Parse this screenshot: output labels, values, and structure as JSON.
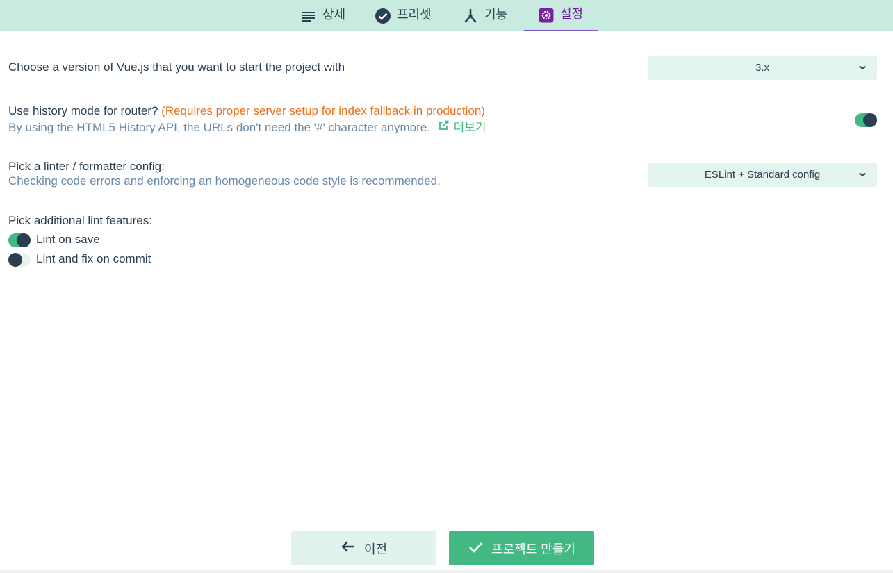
{
  "tabs": [
    {
      "label": "상세",
      "icon": "list-icon",
      "active": false
    },
    {
      "label": "프리셋",
      "icon": "check-circle-icon",
      "active": false
    },
    {
      "label": "기능",
      "icon": "fork-icon",
      "active": false
    },
    {
      "label": "설정",
      "icon": "gear-icon",
      "active": true
    }
  ],
  "vue_version": {
    "title": "Choose a version of Vue.js that you want to start the project with",
    "selected": "3.x"
  },
  "history_mode": {
    "title": "Use history mode for router?",
    "warning": "(Requires proper server setup for index fallback in production)",
    "description": "By using the HTML5 History API, the URLs don't need the '#' character anymore.",
    "more_link": "더보기",
    "enabled": true
  },
  "linter": {
    "title": "Pick a linter / formatter config:",
    "description": "Checking code errors and enforcing an homogeneous code style is recommended.",
    "selected": "ESLint + Standard config"
  },
  "lint_features": {
    "title": "Pick additional lint features:",
    "items": [
      {
        "label": "Lint on save",
        "enabled": true
      },
      {
        "label": "Lint and fix on commit",
        "enabled": false
      }
    ]
  },
  "buttons": {
    "prev_label": "이전",
    "create_label": "프로젝트 만들기"
  },
  "colors": {
    "accent": "#42b883",
    "tab_bar": "#c9eadf",
    "active_tab": "#6a1b9a",
    "warning": "#e8701a",
    "dark": "#2c3e50"
  }
}
